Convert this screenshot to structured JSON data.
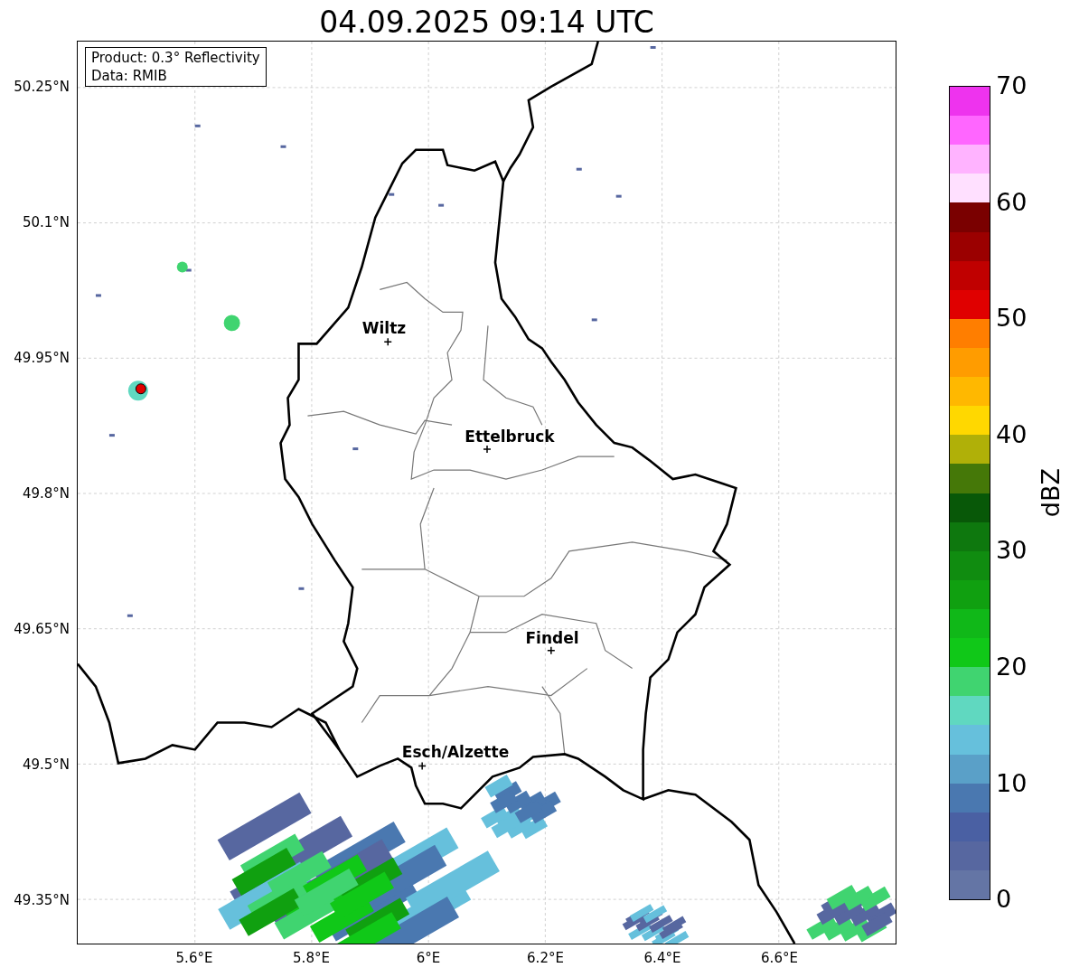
{
  "title": "04.09.2025 09:14 UTC",
  "legend": {
    "lines": [
      "Product: 0.3° Reflectivity",
      "Data: RMIB"
    ]
  },
  "map": {
    "y_ticks": [
      "50.25°N",
      "50.1°N",
      "49.95°N",
      "49.8°N",
      "49.65°N",
      "49.5°N",
      "49.35°N"
    ],
    "x_ticks": [
      "5.6°E",
      "5.8°E",
      "6°E",
      "6.2°E",
      "6.4°E",
      "6.6°E"
    ],
    "places": [
      {
        "name": "Wiltz"
      },
      {
        "name": "Ettelbruck"
      },
      {
        "name": "Findel"
      },
      {
        "name": "Esch/Alzette"
      }
    ]
  },
  "colorbar": {
    "label": "dBZ",
    "ticks": [
      "70",
      "60",
      "50",
      "40",
      "30",
      "20",
      "10",
      "0"
    ],
    "levels": [
      {
        "color": "#ee33ee"
      },
      {
        "color": "#ff66ff"
      },
      {
        "color": "#ffb3ff"
      },
      {
        "color": "#ffe0ff"
      },
      {
        "color": "#7a0000"
      },
      {
        "color": "#9b0000"
      },
      {
        "color": "#c00000"
      },
      {
        "color": "#e00000"
      },
      {
        "color": "#ff7e00"
      },
      {
        "color": "#ff9c00"
      },
      {
        "color": "#ffb800"
      },
      {
        "color": "#ffd800"
      },
      {
        "color": "#b0b008"
      },
      {
        "color": "#457808"
      },
      {
        "color": "#085808"
      },
      {
        "color": "#0e780e"
      },
      {
        "color": "#108c10"
      },
      {
        "color": "#10a010"
      },
      {
        "color": "#10b818"
      },
      {
        "color": "#10c818"
      },
      {
        "color": "#40d470"
      },
      {
        "color": "#60d8c0"
      },
      {
        "color": "#66c0dc"
      },
      {
        "color": "#5aa0c8"
      },
      {
        "color": "#4a78b0"
      },
      {
        "color": "#4a60a3"
      },
      {
        "color": "#5767a0"
      },
      {
        "color": "#6475a5"
      }
    ]
  }
}
